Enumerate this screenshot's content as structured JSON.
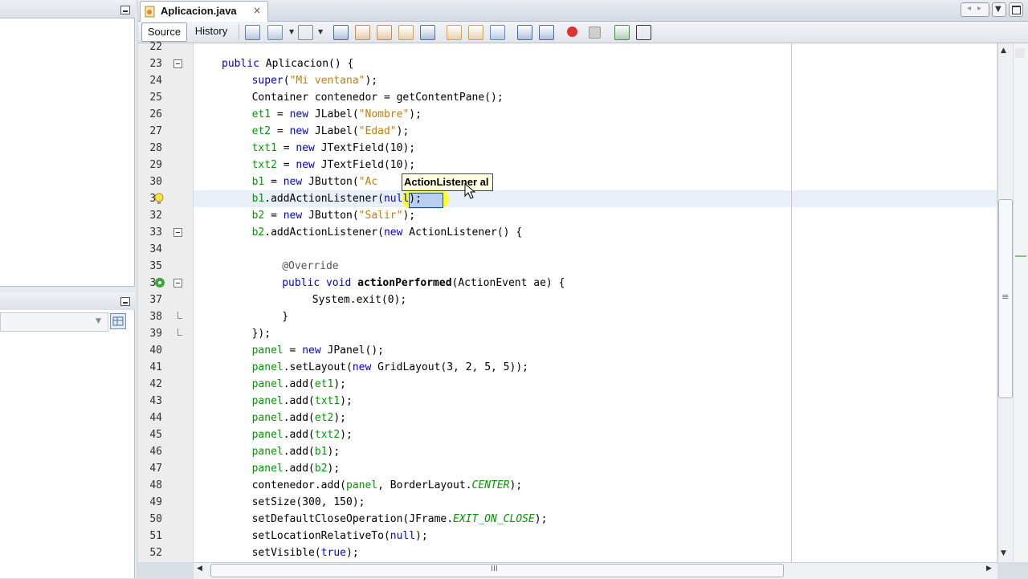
{
  "editor": {
    "tab_title": "Aplicacion.java",
    "tab_close": "×",
    "view_source": "Source",
    "view_history": "History",
    "tooltip": "ActionListener al",
    "hscroll_grip": "III",
    "vscroll_grip": "≡"
  },
  "lines": [
    {
      "n": "22",
      "i": 0,
      "t": []
    },
    {
      "n": "23",
      "i": 1,
      "t": [
        {
          "c": "kw",
          "v": "public"
        },
        {
          "c": "",
          "v": " Aplicacion() {"
        }
      ]
    },
    {
      "n": "24",
      "i": 2,
      "t": [
        {
          "c": "kw",
          "v": "super"
        },
        {
          "c": "",
          "v": "("
        },
        {
          "c": "str",
          "v": "\"Mi ventana\""
        },
        {
          "c": "",
          "v": ");"
        }
      ]
    },
    {
      "n": "25",
      "i": 2,
      "t": [
        {
          "c": "",
          "v": "Container contenedor = getContentPane();"
        }
      ]
    },
    {
      "n": "26",
      "i": 2,
      "t": [
        {
          "c": "fld",
          "v": "et1"
        },
        {
          "c": "",
          "v": " = "
        },
        {
          "c": "kw",
          "v": "new"
        },
        {
          "c": "",
          "v": " JLabel("
        },
        {
          "c": "str",
          "v": "\"Nombre\""
        },
        {
          "c": "",
          "v": ");"
        }
      ]
    },
    {
      "n": "27",
      "i": 2,
      "t": [
        {
          "c": "fld",
          "v": "et2"
        },
        {
          "c": "",
          "v": " = "
        },
        {
          "c": "kw",
          "v": "new"
        },
        {
          "c": "",
          "v": " JLabel("
        },
        {
          "c": "str",
          "v": "\"Edad\""
        },
        {
          "c": "",
          "v": ");"
        }
      ]
    },
    {
      "n": "28",
      "i": 2,
      "t": [
        {
          "c": "fld",
          "v": "txt1"
        },
        {
          "c": "",
          "v": " = "
        },
        {
          "c": "kw",
          "v": "new"
        },
        {
          "c": "",
          "v": " JTextField(10);"
        }
      ]
    },
    {
      "n": "29",
      "i": 2,
      "t": [
        {
          "c": "fld",
          "v": "txt2"
        },
        {
          "c": "",
          "v": " = "
        },
        {
          "c": "kw",
          "v": "new"
        },
        {
          "c": "",
          "v": " JTextField(10);"
        }
      ]
    },
    {
      "n": "30",
      "i": 2,
      "t": [
        {
          "c": "fld",
          "v": "b1"
        },
        {
          "c": "",
          "v": " = "
        },
        {
          "c": "kw",
          "v": "new"
        },
        {
          "c": "",
          "v": " JButton("
        },
        {
          "c": "str",
          "v": "\"Ac"
        }
      ]
    },
    {
      "n": "31",
      "i": 2,
      "t": [
        {
          "c": "fld",
          "v": "b1"
        },
        {
          "c": "",
          "v": ".addActionListener("
        },
        {
          "c": "kw",
          "v": "null"
        },
        {
          "c": "",
          "v": ");"
        }
      ]
    },
    {
      "n": "32",
      "i": 2,
      "t": [
        {
          "c": "fld",
          "v": "b2"
        },
        {
          "c": "",
          "v": " = "
        },
        {
          "c": "kw",
          "v": "new"
        },
        {
          "c": "",
          "v": " JButton("
        },
        {
          "c": "str",
          "v": "\"Salir\""
        },
        {
          "c": "",
          "v": ");"
        }
      ]
    },
    {
      "n": "33",
      "i": 2,
      "t": [
        {
          "c": "fld",
          "v": "b2"
        },
        {
          "c": "",
          "v": ".addActionListener("
        },
        {
          "c": "kw",
          "v": "new"
        },
        {
          "c": "",
          "v": " ActionListener() {"
        }
      ]
    },
    {
      "n": "34",
      "i": 0,
      "t": []
    },
    {
      "n": "35",
      "i": 3,
      "t": [
        {
          "c": "ann",
          "v": "@Override"
        }
      ]
    },
    {
      "n": "36",
      "i": 3,
      "t": [
        {
          "c": "kw",
          "v": "public"
        },
        {
          "c": "",
          "v": " "
        },
        {
          "c": "kw",
          "v": "void"
        },
        {
          "c": "",
          "v": " "
        },
        {
          "c": "bold",
          "v": "actionPerformed"
        },
        {
          "c": "",
          "v": "(ActionEvent ae) {"
        }
      ]
    },
    {
      "n": "37",
      "i": 4,
      "t": [
        {
          "c": "",
          "v": "System."
        },
        {
          "c": "",
          "v": "exit(0);"
        }
      ]
    },
    {
      "n": "38",
      "i": 3,
      "t": [
        {
          "c": "",
          "v": "}"
        }
      ]
    },
    {
      "n": "39",
      "i": 2,
      "t": [
        {
          "c": "",
          "v": "});"
        }
      ]
    },
    {
      "n": "40",
      "i": 2,
      "t": [
        {
          "c": "fld",
          "v": "panel"
        },
        {
          "c": "",
          "v": " = "
        },
        {
          "c": "kw",
          "v": "new"
        },
        {
          "c": "",
          "v": " JPanel();"
        }
      ]
    },
    {
      "n": "41",
      "i": 2,
      "t": [
        {
          "c": "fld",
          "v": "panel"
        },
        {
          "c": "",
          "v": ".setLayout("
        },
        {
          "c": "kw",
          "v": "new"
        },
        {
          "c": "",
          "v": " GridLayout(3, 2, 5, 5));"
        }
      ]
    },
    {
      "n": "42",
      "i": 2,
      "t": [
        {
          "c": "fld",
          "v": "panel"
        },
        {
          "c": "",
          "v": ".add("
        },
        {
          "c": "fld",
          "v": "et1"
        },
        {
          "c": "",
          "v": ");"
        }
      ]
    },
    {
      "n": "43",
      "i": 2,
      "t": [
        {
          "c": "fld",
          "v": "panel"
        },
        {
          "c": "",
          "v": ".add("
        },
        {
          "c": "fld",
          "v": "txt1"
        },
        {
          "c": "",
          "v": ");"
        }
      ]
    },
    {
      "n": "44",
      "i": 2,
      "t": [
        {
          "c": "fld",
          "v": "panel"
        },
        {
          "c": "",
          "v": ".add("
        },
        {
          "c": "fld",
          "v": "et2"
        },
        {
          "c": "",
          "v": ");"
        }
      ]
    },
    {
      "n": "45",
      "i": 2,
      "t": [
        {
          "c": "fld",
          "v": "panel"
        },
        {
          "c": "",
          "v": ".add("
        },
        {
          "c": "fld",
          "v": "txt2"
        },
        {
          "c": "",
          "v": ");"
        }
      ]
    },
    {
      "n": "46",
      "i": 2,
      "t": [
        {
          "c": "fld",
          "v": "panel"
        },
        {
          "c": "",
          "v": ".add("
        },
        {
          "c": "fld",
          "v": "b1"
        },
        {
          "c": "",
          "v": ");"
        }
      ]
    },
    {
      "n": "47",
      "i": 2,
      "t": [
        {
          "c": "fld",
          "v": "panel"
        },
        {
          "c": "",
          "v": ".add("
        },
        {
          "c": "fld",
          "v": "b2"
        },
        {
          "c": "",
          "v": ");"
        }
      ]
    },
    {
      "n": "48",
      "i": 2,
      "t": [
        {
          "c": "",
          "v": "contenedor.add("
        },
        {
          "c": "fld",
          "v": "panel"
        },
        {
          "c": "",
          "v": ", BorderLayout."
        },
        {
          "c": "ital",
          "v": "CENTER"
        },
        {
          "c": "",
          "v": ");"
        }
      ]
    },
    {
      "n": "49",
      "i": 2,
      "t": [
        {
          "c": "",
          "v": "setSize(300, 150);"
        }
      ]
    },
    {
      "n": "50",
      "i": 2,
      "t": [
        {
          "c": "",
          "v": "setDefaultCloseOperation(JFrame."
        },
        {
          "c": "ital",
          "v": "EXIT_ON_CLOSE"
        },
        {
          "c": "",
          "v": ");"
        }
      ]
    },
    {
      "n": "51",
      "i": 2,
      "t": [
        {
          "c": "",
          "v": "setLocationRelativeTo("
        },
        {
          "c": "kw",
          "v": "null"
        },
        {
          "c": "",
          "v": ");"
        }
      ]
    },
    {
      "n": "52",
      "i": 2,
      "t": [
        {
          "c": "",
          "v": "setVisible("
        },
        {
          "c": "kw",
          "v": "true"
        },
        {
          "c": "",
          "v": ");"
        }
      ]
    }
  ],
  "toolbar_icons": [
    "back-icon",
    "forward-dropdown-icon",
    "last-edit-icon",
    "find-icon",
    "find-prev-icon",
    "find-next-icon",
    "toggle-highlight-icon",
    "rect-select-icon",
    "prev-bookmark-icon",
    "next-bookmark-icon",
    "toggle-bookmark-icon",
    "shift-left-icon",
    "shift-right-icon",
    "record-macro-icon",
    "stop-macro-icon",
    "comment-icon",
    "uncomment-icon"
  ],
  "colors": {
    "keyword": "#0000e6",
    "string": "#ce7b00",
    "field": "#009900",
    "highlight": "#ffff00"
  }
}
